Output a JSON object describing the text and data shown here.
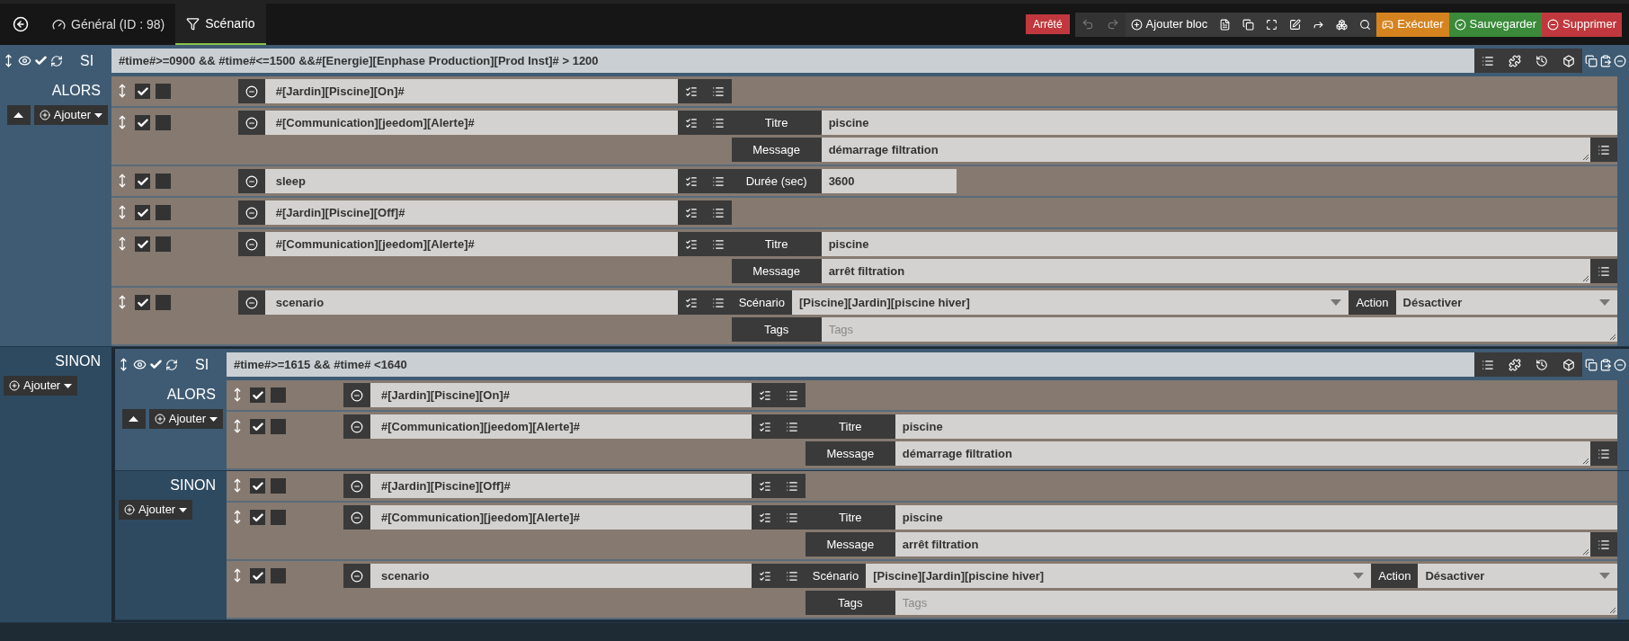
{
  "nav": {
    "tabs": [
      {
        "label": "Général (ID : 98)",
        "selected": false
      },
      {
        "label": "Scénario",
        "selected": true
      }
    ]
  },
  "toolbar": {
    "status": "Arrêté",
    "history": [
      {
        "kind": "undo",
        "disabled": true
      },
      {
        "kind": "redo",
        "disabled": true
      }
    ],
    "add_block": "Ajouter bloc",
    "buttons": [
      {
        "kind": "execute",
        "label": "Exécuter"
      },
      {
        "kind": "save",
        "label": "Sauvegarder"
      },
      {
        "kind": "delete",
        "label": "Supprimer"
      }
    ]
  },
  "block": {
    "keyword": "SI",
    "enabled": true,
    "condition": "#time#>=0900 && #time#<=1500 &&#[Energie][Enphase Production][Prod Inst]# > 1200",
    "then": {
      "label": "ALORS",
      "up_button": true,
      "add": "Ajouter",
      "actions": [
        {
          "enabled": true,
          "parallel": false,
          "command": "#[Jardin][Piscine][On]#"
        },
        {
          "enabled": true,
          "parallel": false,
          "command": "#[Communication][jeedom][Alerte]#",
          "lines": [
            [
              {
                "kind": "text",
                "label": "Titre",
                "value": "piscine"
              }
            ],
            [
              {
                "kind": "textarea",
                "label": "Message",
                "value": "démarrage filtration"
              }
            ]
          ]
        },
        {
          "enabled": true,
          "parallel": false,
          "command": "sleep",
          "lines": [
            [
              {
                "kind": "short",
                "label": "Durée (sec)",
                "value": "3600"
              }
            ]
          ]
        },
        {
          "enabled": true,
          "parallel": false,
          "command": "#[Jardin][Piscine][Off]#"
        },
        {
          "enabled": true,
          "parallel": false,
          "command": "#[Communication][jeedom][Alerte]#",
          "lines": [
            [
              {
                "kind": "text",
                "label": "Titre",
                "value": "piscine"
              }
            ],
            [
              {
                "kind": "textarea",
                "label": "Message",
                "value": "arrêt filtration"
              }
            ]
          ]
        },
        {
          "enabled": true,
          "parallel": false,
          "command": "scenario",
          "lines": [
            [
              {
                "kind": "select",
                "label": "Scénario",
                "value": "[Piscine][Jardin][piscine hiver]"
              },
              {
                "kind": "select",
                "label": "Action",
                "value": "Désactiver"
              }
            ],
            [
              {
                "kind": "tags",
                "label": "Tags",
                "placeholder": "Tags"
              }
            ]
          ]
        }
      ]
    },
    "else": {
      "label": "SINON",
      "up_button": false,
      "add": "Ajouter",
      "block": {
        "keyword": "SI",
        "enabled": true,
        "condition": "#time#>=1615 && #time# <1640",
        "then": {
          "label": "ALORS",
          "up_button": true,
          "add": "Ajouter",
          "actions": [
            {
              "enabled": true,
              "parallel": false,
              "command": "#[Jardin][Piscine][On]#"
            },
            {
              "enabled": true,
              "parallel": false,
              "command": "#[Communication][jeedom][Alerte]#",
              "lines": [
                [
                  {
                    "kind": "text",
                    "label": "Titre",
                    "value": "piscine"
                  }
                ],
                [
                  {
                    "kind": "textarea",
                    "label": "Message",
                    "value": "démarrage filtration"
                  }
                ]
              ]
            }
          ]
        },
        "else": {
          "label": "SINON",
          "up_button": false,
          "add": "Ajouter",
          "actions": [
            {
              "enabled": true,
              "parallel": false,
              "command": "#[Jardin][Piscine][Off]#"
            },
            {
              "enabled": true,
              "parallel": false,
              "command": "#[Communication][jeedom][Alerte]#",
              "lines": [
                [
                  {
                    "kind": "text",
                    "label": "Titre",
                    "value": "piscine"
                  }
                ],
                [
                  {
                    "kind": "textarea",
                    "label": "Message",
                    "value": "arrêt filtration"
                  }
                ]
              ]
            },
            {
              "enabled": true,
              "parallel": false,
              "command": "scenario",
              "lines": [
                [
                  {
                    "kind": "select",
                    "label": "Scénario",
                    "value": "[Piscine][Jardin][piscine hiver]"
                  },
                  {
                    "kind": "select",
                    "label": "Action",
                    "value": "Désactiver"
                  }
                ],
                [
                  {
                    "kind": "tags",
                    "label": "Tags",
                    "placeholder": "Tags"
                  }
                ]
              ]
            }
          ]
        }
      }
    }
  }
}
